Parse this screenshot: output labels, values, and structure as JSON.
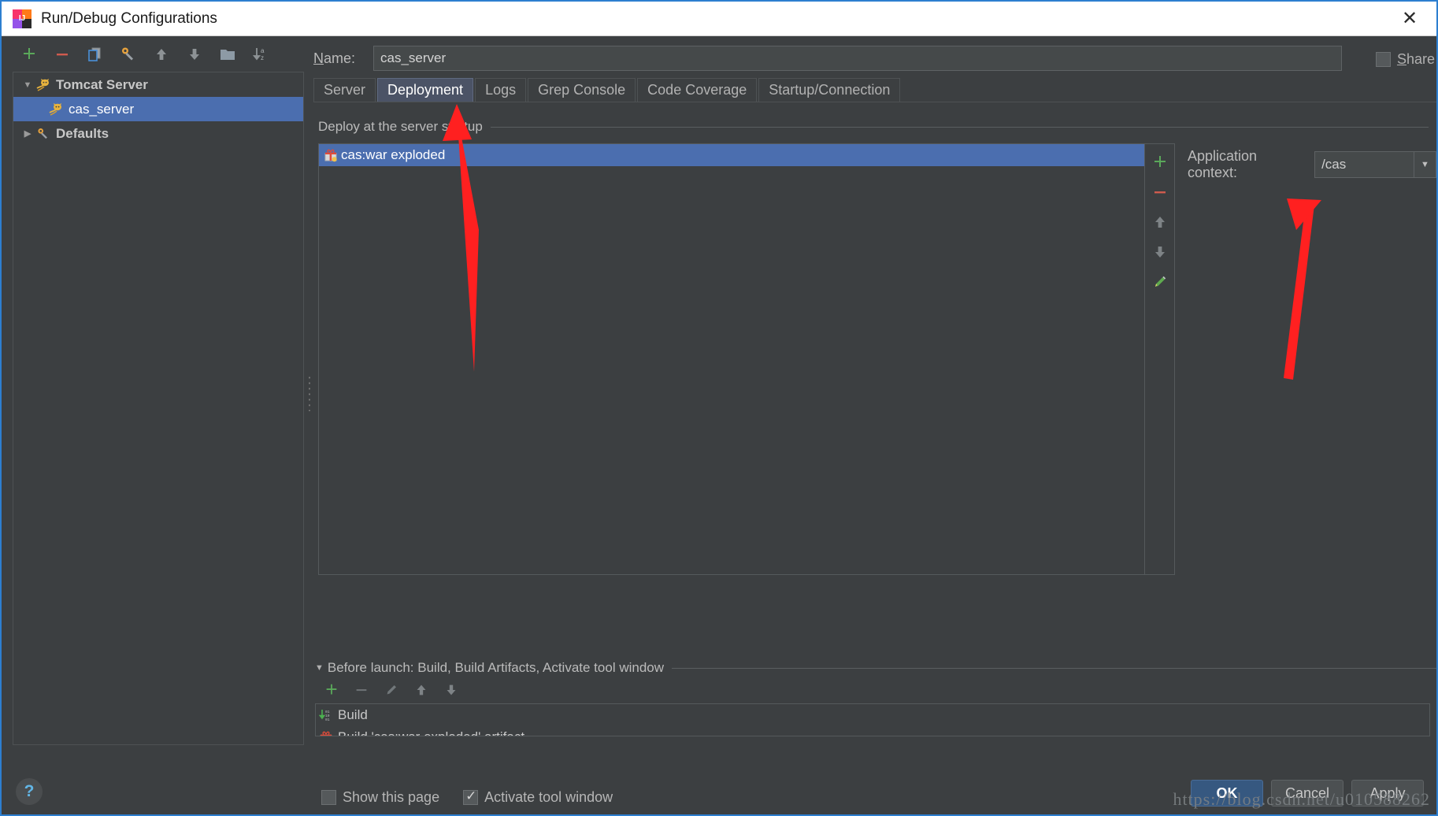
{
  "window": {
    "title": "Run/Debug Configurations",
    "close_icon": "close-icon",
    "logo_text": "IJ"
  },
  "left_toolbar": {
    "buttons": [
      {
        "name": "add-configuration-button",
        "icon": "plus-icon"
      },
      {
        "name": "remove-configuration-button",
        "icon": "minus-icon"
      },
      {
        "name": "copy-configuration-button",
        "icon": "copy-icon"
      },
      {
        "name": "edit-defaults-button",
        "icon": "wrench-icon"
      },
      {
        "name": "move-up-button",
        "icon": "arrow-up-icon"
      },
      {
        "name": "move-down-button",
        "icon": "arrow-down-icon"
      },
      {
        "name": "create-folder-button",
        "icon": "folder-icon"
      },
      {
        "name": "sort-alphabetically-button",
        "icon": "sort-az-icon"
      }
    ]
  },
  "tree": {
    "nodes": [
      {
        "label": "Tomcat Server",
        "icon": "tomcat-icon",
        "expanded": true,
        "selected": false,
        "level": 0
      },
      {
        "label": "cas_server",
        "icon": "tomcat-icon",
        "expanded": null,
        "selected": true,
        "level": 1
      },
      {
        "label": "Defaults",
        "icon": "wrench-icon",
        "expanded": false,
        "selected": false,
        "level": 0
      }
    ]
  },
  "help": {
    "label": "?",
    "name": "help-button"
  },
  "name_field": {
    "label": "Name:",
    "mnemonic": "N",
    "value": "cas_server"
  },
  "share": {
    "label": "Share",
    "mnemonic": "S",
    "checked": false
  },
  "tabs": [
    {
      "label": "Server",
      "active": false
    },
    {
      "label": "Deployment",
      "active": true
    },
    {
      "label": "Logs",
      "active": false
    },
    {
      "label": "Grep Console",
      "active": false
    },
    {
      "label": "Code Coverage",
      "active": false
    },
    {
      "label": "Startup/Connection",
      "active": false
    }
  ],
  "deployment": {
    "section_title": "Deploy at the server startup",
    "artifacts": [
      {
        "label": "cas:war exploded",
        "icon": "artifact-gift-icon",
        "selected": true
      }
    ],
    "side_toolbar": [
      {
        "name": "add-artifact-button",
        "icon": "plus-icon"
      },
      {
        "name": "remove-artifact-button",
        "icon": "minus-icon"
      },
      {
        "name": "move-artifact-up-button",
        "icon": "arrow-up-icon"
      },
      {
        "name": "move-artifact-down-button",
        "icon": "arrow-down-icon"
      },
      {
        "name": "edit-artifact-button",
        "icon": "pencil-icon"
      }
    ],
    "application_context": {
      "label": "Application context:",
      "value": "/cas",
      "dropdown_icon": "chevron-down-icon"
    }
  },
  "before_launch": {
    "header": "Before launch: Build, Build Artifacts, Activate tool window",
    "mnemonic": "B",
    "toolbar": [
      {
        "name": "add-task-button",
        "icon": "plus-icon"
      },
      {
        "name": "remove-task-button",
        "icon": "minus-icon"
      },
      {
        "name": "edit-task-button",
        "icon": "pencil-icon"
      },
      {
        "name": "task-move-up-button",
        "icon": "arrow-up-icon"
      },
      {
        "name": "task-move-down-button",
        "icon": "arrow-down-icon"
      }
    ],
    "tasks": [
      {
        "label": "Build",
        "icon": "build-icon"
      },
      {
        "label": "Build 'cas:war exploded' artifact",
        "icon": "artifact-gift-icon"
      }
    ]
  },
  "options": [
    {
      "label": "Show this page",
      "checked": false,
      "name": "show-this-page-checkbox"
    },
    {
      "label": "Activate tool window",
      "checked": true,
      "name": "activate-tool-window-checkbox"
    }
  ],
  "buttons": {
    "ok": "OK",
    "cancel": "Cancel",
    "apply": "Apply"
  },
  "watermark": "https://blog.csdn.net/u010588262",
  "colors": {
    "accent_selection": "#4b6eaf",
    "tab_active": "#4b5366",
    "primary_button": "#365880",
    "annotation_red": "#ff2020",
    "panel_bg": "#3c3f41"
  }
}
